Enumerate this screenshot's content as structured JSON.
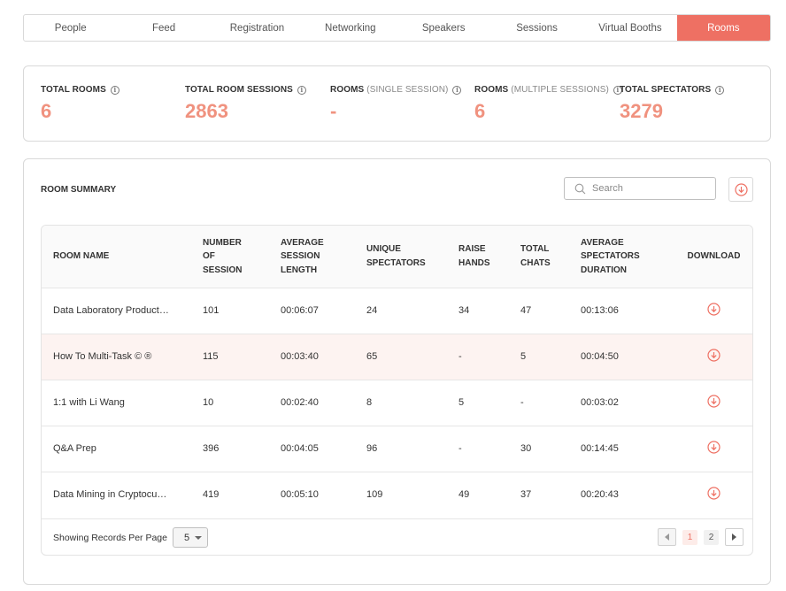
{
  "colors": {
    "accent": "#ee7063",
    "stat_value": "#f0927f",
    "row_highlight": "#fdf3f1"
  },
  "tabs": [
    {
      "label": "People",
      "active": false
    },
    {
      "label": "Feed",
      "active": false
    },
    {
      "label": "Registration",
      "active": false
    },
    {
      "label": "Networking",
      "active": false
    },
    {
      "label": "Speakers",
      "active": false
    },
    {
      "label": "Sessions",
      "active": false
    },
    {
      "label": "Virtual Booths",
      "active": false
    },
    {
      "label": "Rooms",
      "active": true
    }
  ],
  "stats": [
    {
      "label": "TOTAL ROOMS",
      "suffix": "",
      "value": "6",
      "icon": "info-icon"
    },
    {
      "label": "TOTAL ROOM SESSIONS",
      "suffix": "",
      "value": "2863",
      "icon": "info-icon"
    },
    {
      "label": "ROOMS",
      "suffix": "(SINGLE SESSION)",
      "value": "-",
      "icon": "info-icon"
    },
    {
      "label": "ROOMS",
      "suffix": "(MULTIPLE SESSIONS)",
      "value": "6",
      "icon": "info-icon"
    },
    {
      "label": "TOTAL SPECTATORS",
      "suffix": "",
      "value": "3279",
      "icon": "info-icon"
    }
  ],
  "summary": {
    "title": "ROOM SUMMARY",
    "search_placeholder": "Search",
    "search_icon": "search-icon",
    "download_all_icon": "download-circle-icon"
  },
  "table": {
    "headers": [
      [
        "ROOM NAME"
      ],
      [
        "NUMBER",
        "OF",
        "SESSION"
      ],
      [
        "AVERAGE",
        "SESSION",
        "LENGTH"
      ],
      [
        "UNIQUE",
        "SPECTATORS"
      ],
      [
        "RAISE",
        "HANDS"
      ],
      [
        "TOTAL",
        "CHATS"
      ],
      [
        "AVERAGE",
        "SPECTATORS",
        "DURATION"
      ],
      [
        "DOWNLOAD"
      ]
    ],
    "rows": [
      {
        "name": "Data Laboratory Product…",
        "sessions": "101",
        "avg_length": "00:06:07",
        "unique": "24",
        "raise": "34",
        "chats": "47",
        "avg_duration": "00:13:06",
        "highlight": false
      },
      {
        "name": "How To Multi-Task © ®",
        "sessions": "115",
        "avg_length": "00:03:40",
        "unique": "65",
        "raise": "-",
        "chats": "5",
        "avg_duration": "00:04:50",
        "highlight": true
      },
      {
        "name": "1:1 with Li Wang",
        "sessions": "10",
        "avg_length": "00:02:40",
        "unique": "8",
        "raise": "5",
        "chats": "-",
        "avg_duration": "00:03:02",
        "highlight": false
      },
      {
        "name": "Q&A Prep",
        "sessions": "396",
        "avg_length": "00:04:05",
        "unique": "96",
        "raise": "-",
        "chats": "30",
        "avg_duration": "00:14:45",
        "highlight": false
      },
      {
        "name": "Data Mining in Cryptocu…",
        "sessions": "419",
        "avg_length": "00:05:10",
        "unique": "109",
        "raise": "49",
        "chats": "37",
        "avg_duration": "00:20:43",
        "highlight": false
      }
    ]
  },
  "footer": {
    "per_page_label": "Showing Records Per Page",
    "per_page_value": "5",
    "pages": [
      "1",
      "2"
    ],
    "current_page": "1",
    "prev_icon": "chevron-left-icon",
    "next_icon": "chevron-right-icon"
  }
}
